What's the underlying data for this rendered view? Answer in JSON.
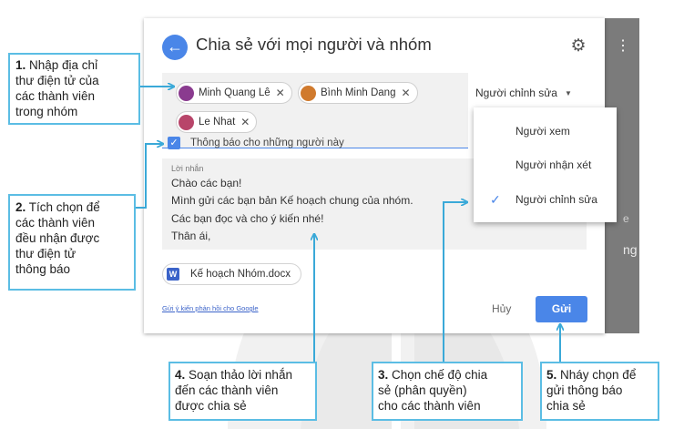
{
  "dialog": {
    "title": "Chia sẻ với mọi người và nhóm",
    "recipients": [
      {
        "name": "Minh Quang Lê",
        "avatar_color": "#8a3b8f"
      },
      {
        "name": "Bình Minh Dang",
        "avatar_color": "#d07a2d"
      },
      {
        "name": "Le Nhat",
        "avatar_color": "#b8456a"
      }
    ],
    "role_select": "Người chỉnh sửa",
    "notify_label": "Thông báo cho những người này",
    "message_label": "Lời nhắn",
    "message_lines": [
      "Chào các bạn!",
      "Mình gửi các bạn bản Kế hoạch chung của nhóm.",
      "Các bạn đọc và cho ý kiến nhé!",
      "Thân ái,"
    ],
    "attachment": "Kế hoạch Nhóm.docx",
    "attachment_icon": "W",
    "feedback_link": "Gửi ý kiến phản hồi cho Google",
    "cancel_label": "Hủy",
    "send_label": "Gửi"
  },
  "role_menu": {
    "items": [
      {
        "label": "Người xem",
        "selected": false
      },
      {
        "label": "Người nhận xét",
        "selected": false
      },
      {
        "label": "Người chỉnh sửa",
        "selected": true
      }
    ]
  },
  "background_window": {
    "partial_text": "ng"
  },
  "callouts": [
    {
      "num": "1.",
      "text": " Nhập địa chỉ\nthư điện tử của\ncác thành viên\ntrong nhóm"
    },
    {
      "num": "2.",
      "text": " Tích chọn để\ncác thành viên\nđều nhận được\nthư điện tử\nthông báo"
    },
    {
      "num": "4.",
      "text": " Soạn thảo lời nhắn\nđến các thành viên\nđược chia sẻ"
    },
    {
      "num": "3.",
      "text": " Chọn chế độ chia\nsẻ (phân quyền)\ncho các thành viên"
    },
    {
      "num": "5.",
      "text": " Nháy chọn để\ngửi thông báo\nchia sẻ"
    }
  ],
  "colors": {
    "accent": "#4a86e8",
    "callout_border": "#5bbde4"
  }
}
